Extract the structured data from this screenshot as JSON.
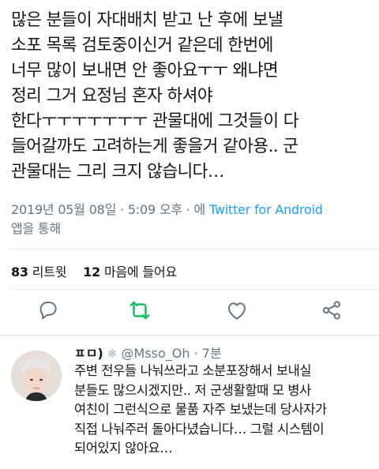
{
  "tweet": {
    "lines": [
      "많은 분들이 자대배치 받고 난 후에 보낼",
      "소포 목록 검토중이신거 같은데 한번에",
      "너무 많이 보내면 안 좋아요ㅜㅜ 왜냐면",
      "정리 그거 요정님 혼자 하셔야",
      "한다ㅜㅜㅜㅜㅜㅜㅜ 관물대에 그것들이 다",
      "들어갈까도 고려하는게 좋을거 같아용.. 군",
      "관물대는 그리 크지 않습니다…"
    ],
    "timestamp": "2019년 05월 08일 · 5:09 오후 · 에 ",
    "source_link": "Twitter for Android",
    "source_suffix": "앱을 통해"
  },
  "stats": {
    "retweet_count": "83",
    "retweet_label": "리트윗",
    "like_count": "12",
    "like_label": "마음에 들어요"
  },
  "actions": {
    "reply_icon": "reply-icon",
    "retweet_icon": "retweet-icon",
    "like_icon": "heart-icon",
    "share_icon": "share-icon",
    "retweet_color": "#17bf63"
  },
  "reply": {
    "name": "ㅍㅁ)",
    "badge_icon": "snowflake-icon",
    "handle": "@Msso_Oh",
    "dot": " · ",
    "time": "7분",
    "lines": [
      "주변 전우들 나눠쓰라고 소분포장해서 보내실",
      "분들도 많으시겠지만.. 저 군생활할때 모 병사",
      "여친이 그런식으로 물품 자주 보냈는데 당사자가",
      "직접 나눠주러 돌아다녔습니다… 그럴 시스템이",
      "되어있지 않아요…"
    ]
  }
}
